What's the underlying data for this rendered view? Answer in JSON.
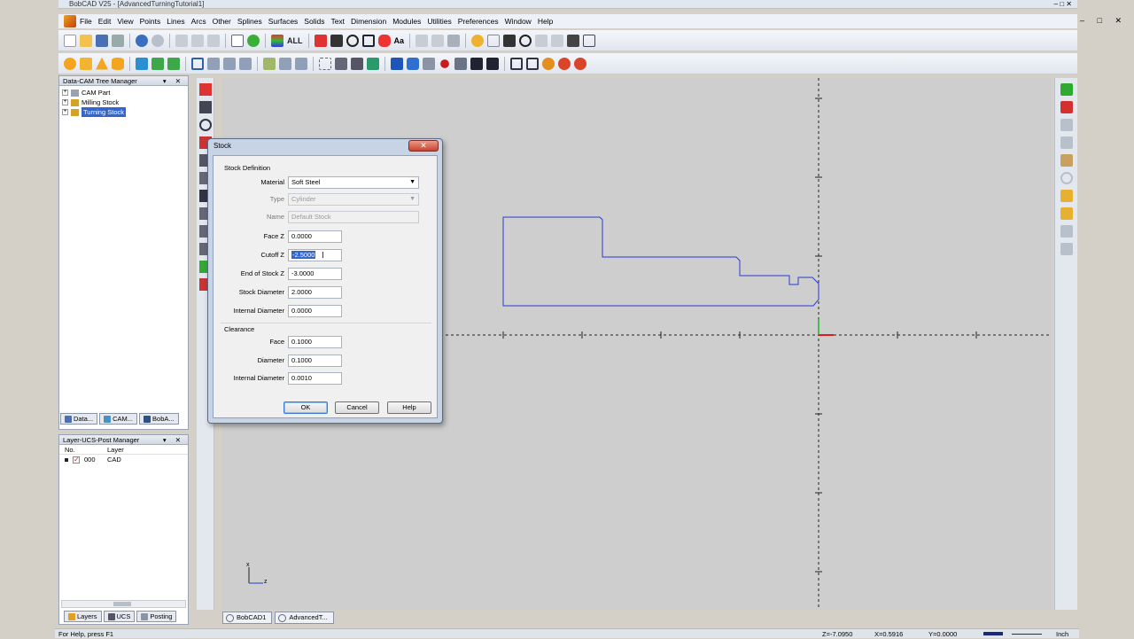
{
  "window": {
    "title": "BobCAD V25 - [AdvancedTurningTutorial1]"
  },
  "menu": [
    "File",
    "Edit",
    "View",
    "Points",
    "Lines",
    "Arcs",
    "Other",
    "Splines",
    "Surfaces",
    "Solids",
    "Text",
    "Dimension",
    "Modules",
    "Utilities",
    "Preferences",
    "Window",
    "Help"
  ],
  "toolbar": {
    "all_label": "ALL",
    "text_label": "Aa"
  },
  "tree_panel": {
    "title": "Data-CAM Tree Manager",
    "items": [
      {
        "label": "CAM Part"
      },
      {
        "label": "Milling Stock"
      },
      {
        "label": "Turning Stock"
      }
    ],
    "tabs": [
      "Data...",
      "CAM...",
      "BobA..."
    ]
  },
  "layer_panel": {
    "title": "Layer-UCS-Post Manager",
    "col_no": "No.",
    "col_layer": "Layer",
    "row": {
      "no": "000",
      "layer": "CAD"
    },
    "tabs": [
      "Layers",
      "UCS",
      "Posting"
    ]
  },
  "doc_tabs": [
    "BobCAD1",
    "AdvancedT..."
  ],
  "axis_triad": {
    "x_label": "x",
    "z_label": "z"
  },
  "status": {
    "help": "For Help, press F1",
    "z": "Z=-7.0950",
    "x": "X=0.5916",
    "y": "Y=0.0000",
    "units": "Inch"
  },
  "dialog": {
    "title": "Stock",
    "group_stock": "Stock Definition",
    "material": {
      "label": "Material",
      "value": "Soft Steel"
    },
    "type": {
      "label": "Type",
      "value": "Cylinder"
    },
    "name": {
      "label": "Name",
      "value": "Default Stock"
    },
    "face_z": {
      "label": "Face Z",
      "value": "0.0000"
    },
    "cutoff_z": {
      "label": "Cutoff Z",
      "value": "-2.5000"
    },
    "end_z": {
      "label": "End of Stock Z",
      "value": "-3.0000"
    },
    "stock_diameter": {
      "label": "Stock Diameter",
      "value": "2.0000"
    },
    "internal_diameter": {
      "label": "Internal Diameter",
      "value": "0.0000"
    },
    "group_clearance": "Clearance",
    "cl_face": {
      "label": "Face",
      "value": "0.1000"
    },
    "cl_diameter": {
      "label": "Diameter",
      "value": "0.1000"
    },
    "cl_internal": {
      "label": "Internal Diameter",
      "value": "0.0010"
    },
    "ok": "OK",
    "cancel": "Cancel",
    "help": "Help"
  },
  "colors": {
    "profile": "#2b3bd6",
    "axis_x": "#d62020",
    "axis_y": "#22b022",
    "selection": "#3366cc"
  }
}
